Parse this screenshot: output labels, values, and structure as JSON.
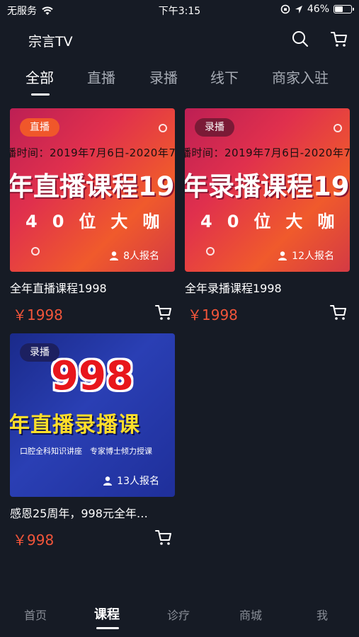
{
  "status": {
    "carrier": "无服务",
    "time": "下午3:15",
    "battery": "46%",
    "battery_level": 0.46
  },
  "app_title": "宗言TV",
  "tabs": [
    "全部",
    "直播",
    "录播",
    "线下",
    "商家入驻"
  ],
  "active_tab": "全部",
  "courses": [
    {
      "badge": "直播",
      "image_line1": "播时间：2019年7月6日-2020年7",
      "image_line2": "年直播课程19",
      "image_line3": "40位大咖",
      "signup": "8人报名",
      "title": "全年直播课程1998",
      "price": "￥1998"
    },
    {
      "badge": "录播",
      "image_line1": "播时间：2019年7月6日-2020年7",
      "image_line2": "年录播课程19",
      "image_line3": "40位大咖",
      "signup": "12人报名",
      "title": "全年录播课程1998",
      "price": "￥1998"
    },
    {
      "badge": "录播",
      "image_line1": "998",
      "image_line2": "年直播录播课",
      "image_line3": "口腔全科知识讲座　专家博士倾力授课",
      "signup": "13人报名",
      "title": "感恩25周年，998元全年…",
      "price": "￥998"
    }
  ],
  "bottom_nav": [
    "首页",
    "课程",
    "诊疗",
    "商城",
    "我"
  ],
  "active_nav": "课程",
  "colors": {
    "background": "#161b25",
    "price": "#f2553a",
    "badge_live": "#f0572a",
    "inactive_text": "#8a8f98"
  }
}
